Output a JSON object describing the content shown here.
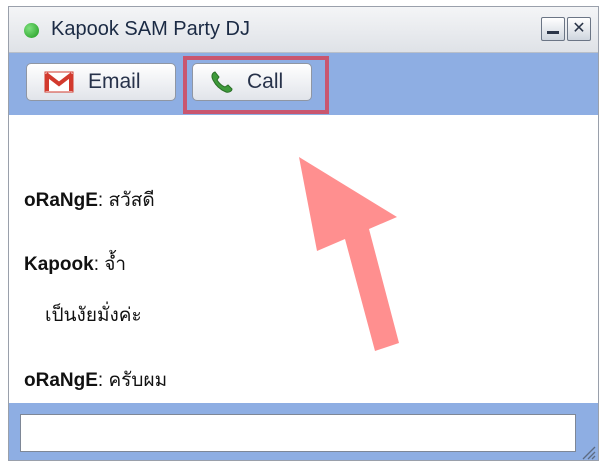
{
  "window": {
    "title": "Kapook SAM Party DJ",
    "status": "online",
    "status_color": "#22a322"
  },
  "toolbar": {
    "email_label": "Email",
    "call_label": "Call",
    "email_icon": "gmail-icon",
    "call_icon": "phone-icon"
  },
  "messages": [
    {
      "sender": "oRaNgE",
      "text": "สวัสดี"
    },
    {
      "sender": "Kapook",
      "text": "จ้ำ"
    },
    {
      "sender": "",
      "text": "เป็นงัยมั่งค่ะ"
    },
    {
      "sender": "oRaNgE",
      "text": "ครับผม"
    }
  ],
  "input": {
    "value": "",
    "placeholder": ""
  },
  "annotation": {
    "highlight_color": "#c9566f",
    "arrow_color": "#ff8f8f",
    "target": "call-button"
  }
}
